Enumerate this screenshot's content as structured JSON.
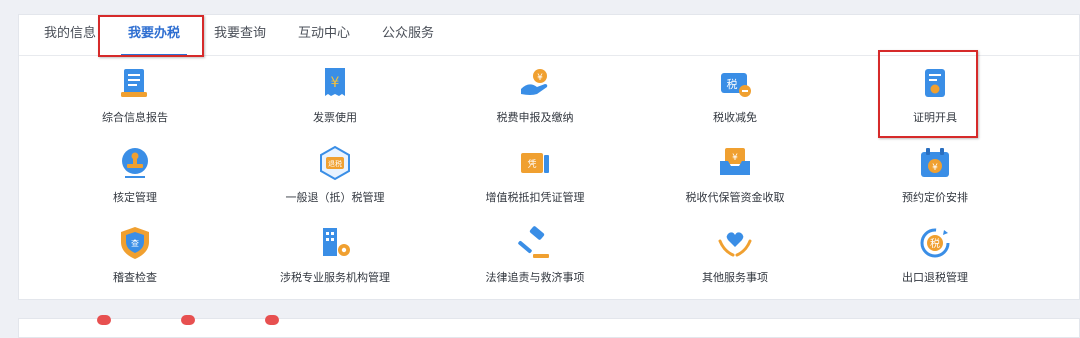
{
  "tabs": [
    {
      "label": "我的信息"
    },
    {
      "label": "我要办税"
    },
    {
      "label": "我要查询"
    },
    {
      "label": "互动中心"
    },
    {
      "label": "公众服务"
    }
  ],
  "active_tab": "我要办税",
  "services": [
    {
      "label": "综合信息报告",
      "icon": "document-icon"
    },
    {
      "label": "发票使用",
      "icon": "invoice-yen-icon"
    },
    {
      "label": "税费申报及缴纳",
      "icon": "hand-coin-icon"
    },
    {
      "label": "税收减免",
      "icon": "tax-reduction-icon"
    },
    {
      "label": "证明开具",
      "icon": "certificate-icon"
    },
    {
      "label": "核定管理",
      "icon": "stamp-icon"
    },
    {
      "label": "一般退（抵）税管理",
      "icon": "tax-refund-icon"
    },
    {
      "label": "增值税抵扣凭证管理",
      "icon": "voucher-icon"
    },
    {
      "label": "税收代保管资金收取",
      "icon": "fund-box-icon"
    },
    {
      "label": "预约定价安排",
      "icon": "calendar-yen-icon"
    },
    {
      "label": "稽查检查",
      "icon": "shield-check-icon"
    },
    {
      "label": "涉税专业服务机构管理",
      "icon": "building-gear-icon"
    },
    {
      "label": "法律追责与救济事项",
      "icon": "gavel-icon"
    },
    {
      "label": "其他服务事项",
      "icon": "heart-hands-icon"
    },
    {
      "label": "出口退税管理",
      "icon": "tax-return-icon"
    }
  ],
  "colors": {
    "accent": "#2f6fd1",
    "icon_blue": "#3a8ee6",
    "icon_orange": "#f0a030",
    "highlight_red": "#d62a2a"
  }
}
